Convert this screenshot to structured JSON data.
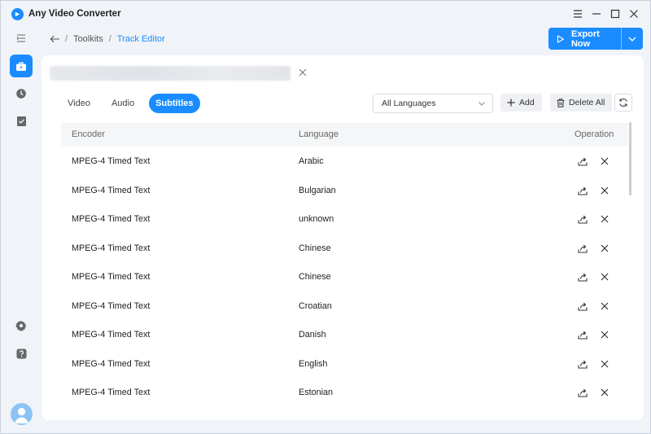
{
  "app": {
    "title": "Any Video Converter"
  },
  "breadcrumb": {
    "root": "Toolkits",
    "current": "Track Editor"
  },
  "export": {
    "label": "Export Now"
  },
  "tabs": [
    {
      "label": "Video",
      "active": false
    },
    {
      "label": "Audio",
      "active": false
    },
    {
      "label": "Subtitles",
      "active": true
    }
  ],
  "filters": {
    "language_selected": "All Languages"
  },
  "actions": {
    "add_label": "Add",
    "delete_all_label": "Delete All"
  },
  "table": {
    "columns": [
      "Encoder",
      "Language",
      "Operation"
    ],
    "rows": [
      {
        "encoder": "MPEG-4 Timed Text",
        "language": "Arabic"
      },
      {
        "encoder": "MPEG-4 Timed Text",
        "language": "Bulgarian"
      },
      {
        "encoder": "MPEG-4 Timed Text",
        "language": "unknown"
      },
      {
        "encoder": "MPEG-4 Timed Text",
        "language": "Chinese"
      },
      {
        "encoder": "MPEG-4 Timed Text",
        "language": "Chinese"
      },
      {
        "encoder": "MPEG-4 Timed Text",
        "language": "Croatian"
      },
      {
        "encoder": "MPEG-4 Timed Text",
        "language": "Danish"
      },
      {
        "encoder": "MPEG-4 Timed Text",
        "language": "English"
      },
      {
        "encoder": "MPEG-4 Timed Text",
        "language": "Estonian"
      }
    ]
  },
  "colors": {
    "accent": "#1a8cff",
    "background": "#f0f3f8",
    "panel": "#ffffff"
  },
  "icons": {
    "sidebar": [
      "menu-icon",
      "toolbox-icon",
      "history-icon",
      "tasks-icon",
      "settings-icon",
      "help-icon",
      "avatar"
    ],
    "row_ops": [
      "edit-export-icon",
      "delete-icon"
    ]
  }
}
